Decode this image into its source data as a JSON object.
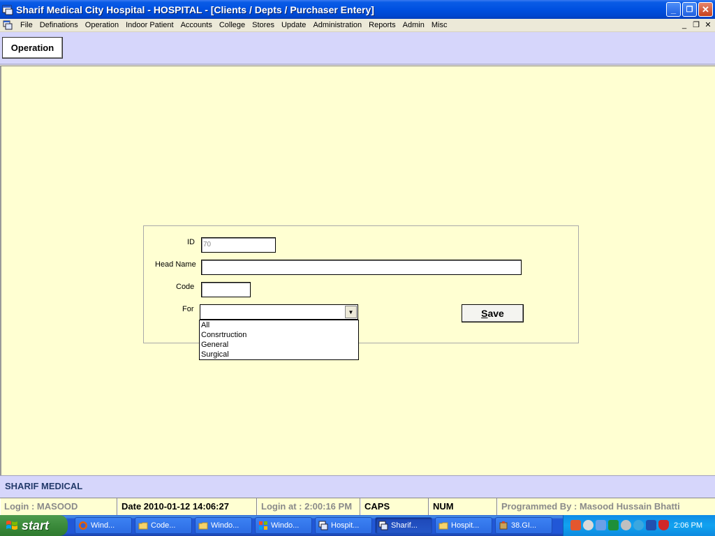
{
  "window": {
    "title": "Sharif Medical City Hospital - HOSPITAL - [Clients / Depts / Purchaser Entery]",
    "minimize": "_",
    "restore": "❐",
    "close": "✕"
  },
  "menubar": {
    "items": [
      "File",
      "Definations",
      "Operation",
      "Indoor Patient",
      "Accounts",
      "College",
      "Stores",
      "Update",
      "Administration",
      "Reports",
      "Admin",
      "Misc"
    ],
    "mdi_min": "_",
    "mdi_restore": "❐",
    "mdi_close": "✕"
  },
  "toolbar": {
    "operation_label": "Operation"
  },
  "form": {
    "id_label": "ID",
    "id_value": "70",
    "head_name_label": "Head Name",
    "head_name_value": "",
    "code_label": "Code",
    "code_value": "",
    "for_label": "For",
    "for_value": "",
    "for_options": [
      "All",
      "Consrtruction",
      "General",
      "Surgical"
    ],
    "save_label": "Save"
  },
  "brand": {
    "text": "SHARIF MEDICAL"
  },
  "status": {
    "login": "Login :  MASOOD",
    "date": "Date 2010-01-12 14:06:27",
    "login_at": "Login at : 2:00:16 PM",
    "caps": "CAPS",
    "num": "NUM",
    "programmed_by": "Programmed By : Masood Hussain Bhatti"
  },
  "taskbar": {
    "start_label": "start",
    "tasks": [
      "Wind...",
      "Code...",
      "Windo...",
      "Windo...",
      "Hospit...",
      "Sharif...",
      "Hospit...",
      "38.GI..."
    ],
    "clock": "2:06 PM"
  },
  "colors": {
    "main_bg": "#ffffd2",
    "strip_bg": "#d6d6fb",
    "title_blue": "#0050e0"
  }
}
